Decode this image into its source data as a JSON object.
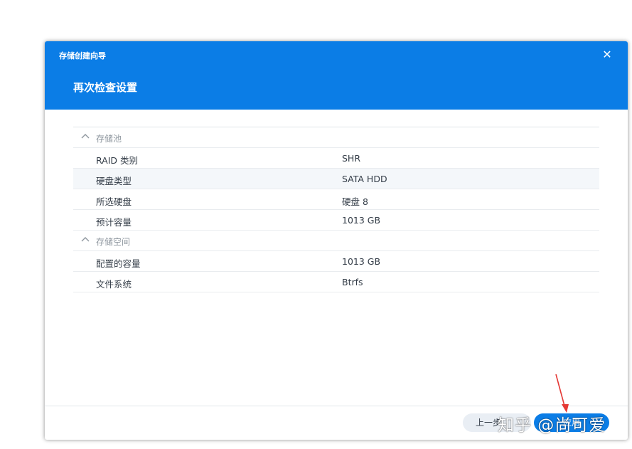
{
  "dialog": {
    "wizard_title": "存储创建向导",
    "step_title": "再次检查设置",
    "close_icon": "close-icon"
  },
  "summary": {
    "sections": [
      {
        "title": "存储池",
        "rows": [
          {
            "label": "RAID 类别",
            "value": "SHR"
          },
          {
            "label": "硬盘类型",
            "value": "SATA HDD"
          },
          {
            "label": "所选硬盘",
            "value": "硬盘 8"
          },
          {
            "label": "预计容量",
            "value": "1013 GB"
          }
        ]
      },
      {
        "title": "存储空间",
        "rows": [
          {
            "label": "配置的容量",
            "value": "1013 GB"
          },
          {
            "label": "文件系统",
            "value": "Btrfs"
          }
        ]
      }
    ]
  },
  "footer": {
    "prev_label": "上一步",
    "next_label": "应用"
  },
  "watermark": "知乎 @尚可爱",
  "colors": {
    "accent": "#0b7de6",
    "annotation_arrow": "#e53935"
  }
}
